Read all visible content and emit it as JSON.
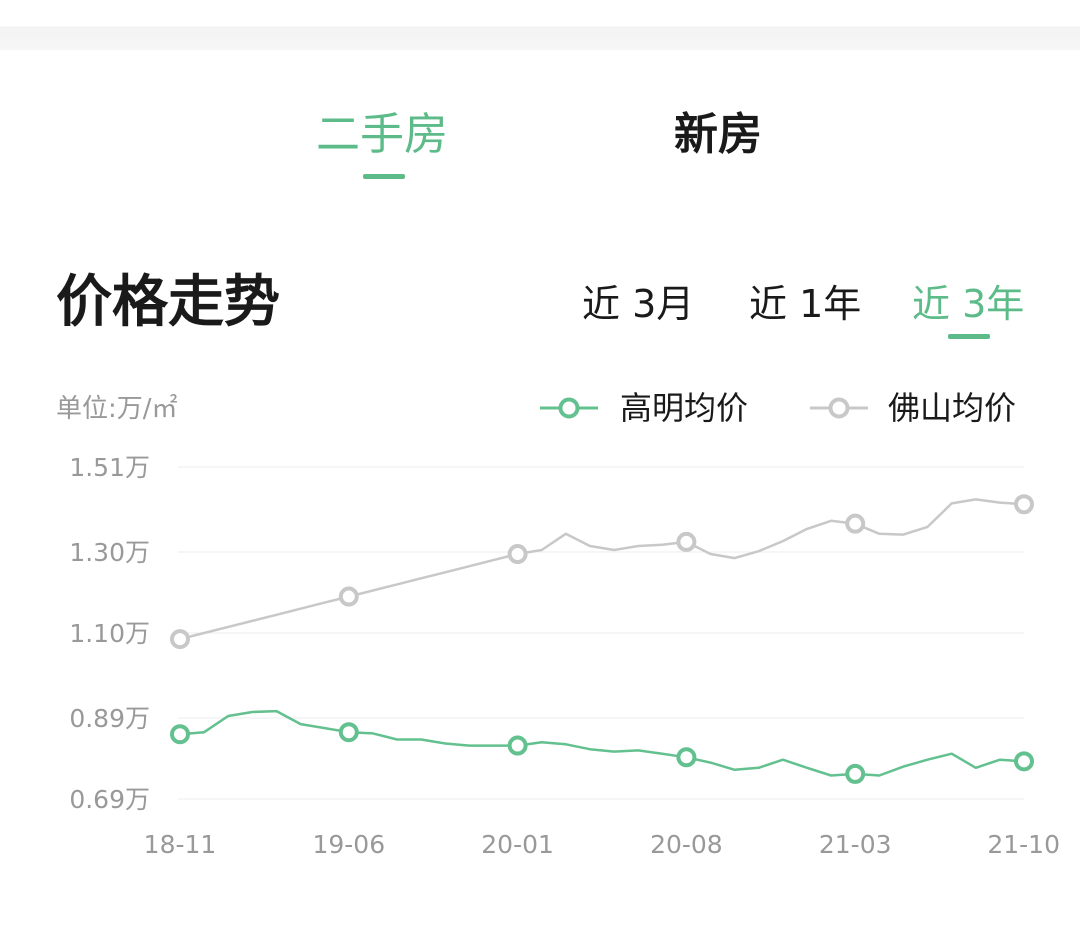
{
  "tabs": {
    "used": "二手房",
    "new": "新房",
    "active": "used"
  },
  "section_title": "价格走势",
  "ranges": {
    "m3": "近 3月",
    "y1": "近 1年",
    "y3": "近 3年",
    "active": "y3"
  },
  "unit_label": "单位:万/㎡",
  "colors": {
    "accent": "#5dbb8a",
    "gaoming_line": "#63c08f",
    "foshan_line": "#c8c8c8",
    "grid": "#eeeeee",
    "axis_text": "#999999"
  },
  "chart_data": {
    "type": "line",
    "xlabel": "",
    "ylabel": "",
    "y_tick_labels": [
      "1.51万",
      "1.30万",
      "1.10万",
      "0.89万",
      "0.69万"
    ],
    "y_tick_values": [
      1.51,
      1.3,
      1.1,
      0.89,
      0.69
    ],
    "ylim": [
      0.69,
      1.51
    ],
    "x_tick_labels": [
      "18-11",
      "19-06",
      "20-01",
      "20-08",
      "21-03",
      "21-10"
    ],
    "x": [
      "18-11",
      "18-12",
      "19-01",
      "19-02",
      "19-03",
      "19-04",
      "19-05",
      "19-06",
      "19-07",
      "19-08",
      "19-09",
      "19-10",
      "19-11",
      "19-12",
      "20-01",
      "20-02",
      "20-03",
      "20-04",
      "20-05",
      "20-06",
      "20-07",
      "20-08",
      "20-09",
      "20-10",
      "20-11",
      "20-12",
      "21-01",
      "21-02",
      "21-03",
      "21-04",
      "21-05",
      "21-06",
      "21-07",
      "21-08",
      "21-09",
      "21-10"
    ],
    "marker_every": 7,
    "legend_position": "top-right",
    "grid": true,
    "series": [
      {
        "name": "高明均价",
        "color": "#63c08f",
        "values": [
          0.85,
          0.855,
          0.895,
          0.905,
          0.907,
          0.875,
          0.865,
          0.855,
          0.852,
          0.837,
          0.837,
          0.827,
          0.822,
          0.822,
          0.822,
          0.83,
          0.825,
          0.813,
          0.807,
          0.81,
          0.802,
          0.793,
          0.78,
          0.762,
          0.767,
          0.787,
          0.767,
          0.748,
          0.752,
          0.748,
          0.77,
          0.787,
          0.802,
          0.767,
          0.787,
          0.783
        ]
      },
      {
        "name": "佛山均价",
        "color": "#c8c8c8",
        "values": [
          1.085,
          1.1,
          1.115,
          1.13,
          1.145,
          1.16,
          1.175,
          1.19,
          1.205,
          1.22,
          1.235,
          1.25,
          1.265,
          1.28,
          1.295,
          1.305,
          1.345,
          1.315,
          1.305,
          1.315,
          1.318,
          1.325,
          1.295,
          1.285,
          1.302,
          1.327,
          1.357,
          1.377,
          1.37,
          1.345,
          1.343,
          1.362,
          1.42,
          1.43,
          1.422,
          1.418
        ]
      }
    ]
  }
}
